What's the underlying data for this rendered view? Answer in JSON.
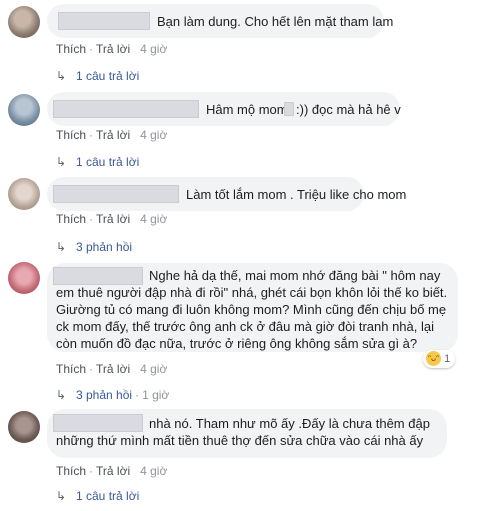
{
  "actions": {
    "like": "Thích",
    "reply": "Trả lời",
    "sep": "·"
  },
  "comments": [
    {
      "text": "Bạn làm dung. Cho hết lên mặt tham lam",
      "time": "4 giờ",
      "replies": "1 câu trả lời",
      "avatar_color": "#8a7a70"
    },
    {
      "text_a": "Hâm mộ mom",
      "text_b": ":)) đọc mà hả hê v",
      "time": "4 giờ",
      "replies": "1 câu trả lời",
      "avatar_color": "#7a8fa3"
    },
    {
      "text": "Làm tốt lắm mom . Triệu like cho mom",
      "time": "4 giờ",
      "replies": "3 phản hồi",
      "avatar_color": "#b8a59a"
    },
    {
      "line1": "Nghe hả dạ thế, mai mom nhớ đăng bài \" hôm nay",
      "line2": "em thuê người đập nhà đi rồi\" nhá, ghét cái bọn khôn lỏi thế ko biết.",
      "line3": "Giường tủ có mang đi luôn không mom? Mình cũng đến chịu bố mẹ",
      "line4": "ck mom đấy, thế trước ông anh ck ở đâu mà giờ đòi tranh nhà, lại",
      "line5": "còn muốn đồ đạc nữa, trước ở riêng ông không sắm sửa gì à?",
      "time": "4 giờ",
      "reaction_count": "1",
      "replies": "3 phản hồi",
      "replies_time": "1 giờ",
      "avatar_color": "#c46a76"
    },
    {
      "line1": "nhà nó. Tham như mõ ấy .Đấy là chưa thêm đập",
      "line2": "những thứ mình mất tiền thuê thợ đến sửa chữa vào cái nhà ấy",
      "time": "4 giờ",
      "replies": "1 câu trả lời",
      "avatar_color": "#6e5a55"
    }
  ]
}
